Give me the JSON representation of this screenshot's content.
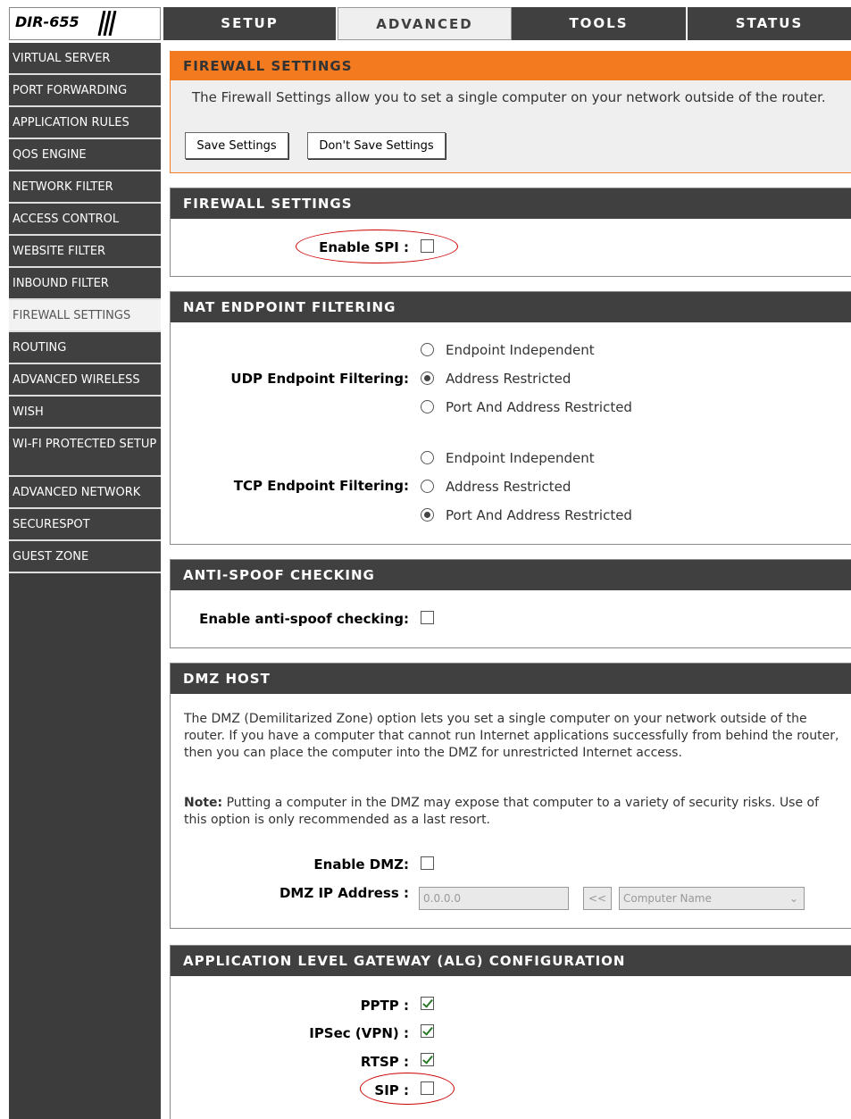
{
  "header": {
    "model": "DIR-655",
    "tabs": [
      {
        "label": "SETUP"
      },
      {
        "label": "ADVANCED"
      },
      {
        "label": "TOOLS"
      },
      {
        "label": "STATUS"
      }
    ]
  },
  "sidebar": {
    "items": [
      {
        "label": "VIRTUAL SERVER"
      },
      {
        "label": "PORT FORWARDING"
      },
      {
        "label": "APPLICATION RULES"
      },
      {
        "label": "QOS ENGINE"
      },
      {
        "label": "NETWORK FILTER"
      },
      {
        "label": "ACCESS CONTROL"
      },
      {
        "label": "WEBSITE FILTER"
      },
      {
        "label": "INBOUND FILTER"
      },
      {
        "label": "FIREWALL SETTINGS"
      },
      {
        "label": "ROUTING"
      },
      {
        "label": "ADVANCED WIRELESS"
      },
      {
        "label": "WISH"
      },
      {
        "label": "WI-FI PROTECTED SETUP"
      },
      {
        "label": "ADVANCED NETWORK"
      },
      {
        "label": "SECURESPOT"
      },
      {
        "label": "GUEST ZONE"
      }
    ]
  },
  "intro": {
    "title": "FIREWALL SETTINGS",
    "text": "The Firewall Settings allow you to set a single computer on your network outside of the router.",
    "save_label": "Save Settings",
    "dont_save_label": "Don't Save Settings"
  },
  "firewall": {
    "title": "FIREWALL SETTINGS",
    "spi_label": "Enable SPI :",
    "spi_checked": false
  },
  "nat": {
    "title": "NAT ENDPOINT FILTERING",
    "udp_label": "UDP Endpoint Filtering:",
    "tcp_label": "TCP Endpoint Filtering:",
    "options": [
      "Endpoint Independent",
      "Address Restricted",
      "Port And Address Restricted"
    ],
    "udp_selected": "Address Restricted",
    "tcp_selected": "Port And Address Restricted"
  },
  "antispoof": {
    "title": "ANTI-SPOOF CHECKING",
    "label": "Enable anti-spoof checking:",
    "checked": false
  },
  "dmz": {
    "title": "DMZ HOST",
    "desc": "The DMZ (Demilitarized Zone) option lets you set a single computer on your network outside of the router. If you have a computer that cannot run Internet applications successfully from behind the router, then you can place the computer into the DMZ for unrestricted Internet access.",
    "note_label": "Note:",
    "note_text": " Putting a computer in the DMZ may expose that computer to a variety of security risks. Use of this option is only recommended as a last resort.",
    "enable_label": "Enable DMZ:",
    "enable_checked": false,
    "ip_label": "DMZ IP Address :",
    "ip_value": "0.0.0.0",
    "copy_button": "<<",
    "computer_select": "Computer Name"
  },
  "alg": {
    "title": "APPLICATION LEVEL GATEWAY (ALG) CONFIGURATION",
    "items": [
      {
        "label": "PPTP :",
        "checked": true
      },
      {
        "label": "IPSec (VPN) :",
        "checked": true
      },
      {
        "label": "RTSP :",
        "checked": true
      },
      {
        "label": "SIP :",
        "checked": false
      }
    ]
  },
  "colors": {
    "orange": "#f47a20",
    "dark": "#404040",
    "highlight": "#cc0000"
  }
}
